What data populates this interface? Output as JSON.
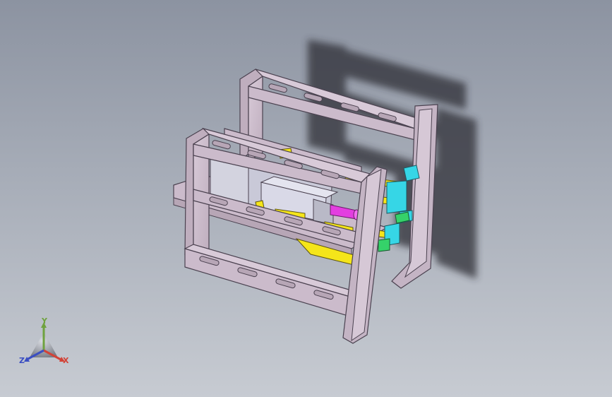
{
  "view": {
    "background_top": "#8c93a1",
    "background_bottom": "#c7cbd2",
    "model_colors": {
      "frame": "#cdbecd",
      "frame_edge": "#4b4250",
      "yellow_parts": "#f5e51a",
      "cyan_parts": "#36d6e6",
      "green_parts": "#35d26a",
      "magenta_parts": "#e33ee0",
      "sheet_metal": "#d9d9e7",
      "shadow": "#2a2c31"
    }
  },
  "triad": {
    "axis_y": "Y",
    "axis_x": "X",
    "axis_z": "Z",
    "x_color": "#d24337",
    "y_color": "#6fa23f",
    "z_color": "#3b4fc2"
  }
}
